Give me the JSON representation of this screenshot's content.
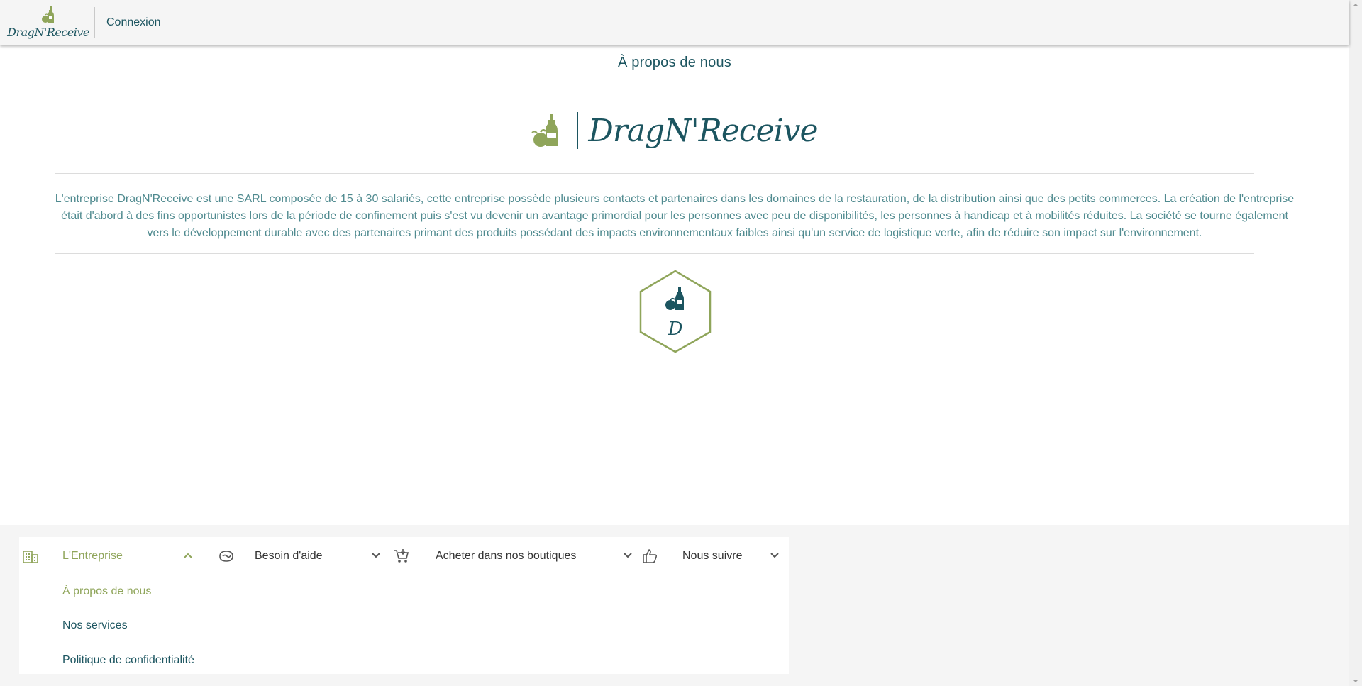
{
  "header": {
    "brand": "DragN'Receive",
    "login_label": "Connexion"
  },
  "main": {
    "title": "À propos de nous",
    "hero_brand": "DragN'Receive",
    "description": "L'entreprise DragN'Receive est une SARL composée de 15 à 30 salariés, cette entreprise possède plusieurs contacts et partenaires dans les domaines de la restauration, de la distribution ainsi que des petits commerces. La création de l'entreprise était d'abord à des fins opportunistes lors de la période de confinement puis s'est vu devenir un avantage primordial pour les personnes avec peu de disponibilités, les personnes à handicap et à mobilités réduites. La société se tourne également vers le développement durable avec des partenaires primant des produits possédant des impacts environnementaux faibles ainsi qu'un service de logistique verte, afin de réduire son impact sur l'environnement.",
    "hex_letter": "D"
  },
  "footer": {
    "groups": [
      {
        "label": "L'Entreprise",
        "icon": "building-icon",
        "expanded": true
      },
      {
        "label": "Besoin d'aide",
        "icon": "help-handshake-icon",
        "expanded": false
      },
      {
        "label": "Acheter dans nos boutiques",
        "icon": "cart-add-icon",
        "expanded": false
      },
      {
        "label": "Nous suivre",
        "icon": "thumbs-up-icon",
        "expanded": false
      }
    ],
    "entreprise_items": [
      {
        "label": "À propos de nous",
        "active": true
      },
      {
        "label": "Nos services",
        "active": false
      },
      {
        "label": "Politique de confidentialité",
        "active": false
      }
    ]
  },
  "colors": {
    "primary": "#1c5560",
    "accent_green": "#8fa55a",
    "text_muted": "#4f8a8f",
    "background": "#f5f5f5"
  }
}
